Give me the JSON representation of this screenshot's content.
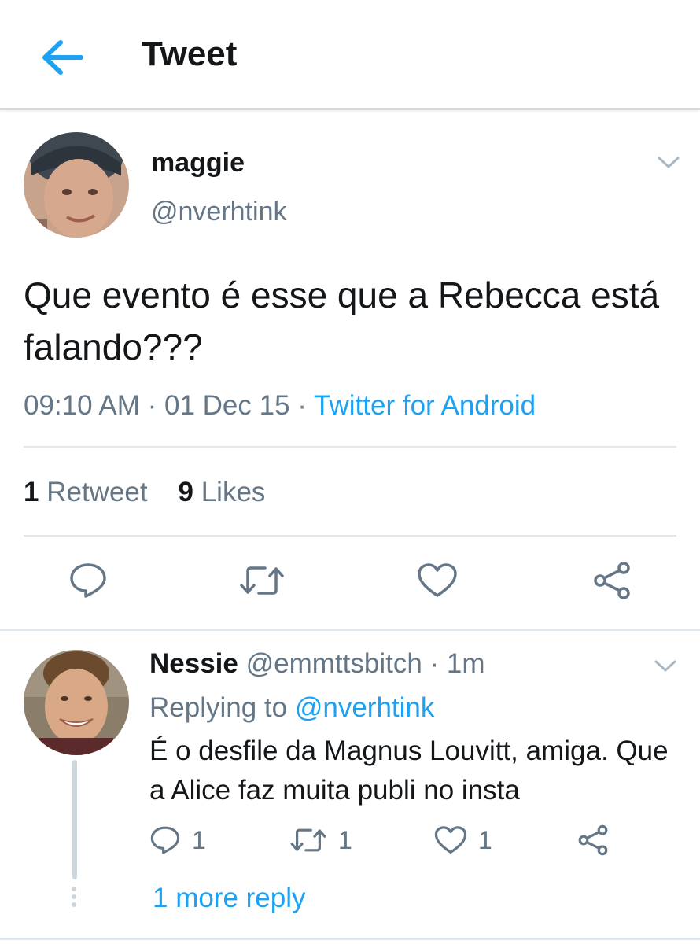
{
  "header": {
    "title": "Tweet",
    "back_icon": "arrow-left-icon",
    "accent": "#1da1f2"
  },
  "tweet": {
    "author_name": "maggie",
    "author_handle": "@nverhtink",
    "text": "Que evento é esse que a Rebecca está falando???",
    "time": "09:10 AM",
    "sep1": " · ",
    "date": "01 Dec 15",
    "sep2": " · ",
    "source": "Twitter for Android",
    "retweet_count": "1",
    "retweet_label": "Retweet",
    "like_count": "9",
    "like_label": "Likes",
    "actions": [
      "reply-icon",
      "retweet-icon",
      "like-icon",
      "share-icon"
    ]
  },
  "reply": {
    "author_name": "Nessie",
    "author_handle": "@emmttsbitch",
    "sep": " · ",
    "time": "1m",
    "replying_prefix": "Replying to ",
    "replying_to": "@nverhtink",
    "text": "É o desfile da Magnus Louvitt, amiga. Que a Alice faz muita publi no insta",
    "reply_count": "1",
    "retweet_count": "1",
    "like_count": "1",
    "more_replies": "1 more reply"
  },
  "colors": {
    "text": "#14171a",
    "secondary": "#657786",
    "link": "#1da1f2",
    "divider": "#e1e8ed",
    "icon": "#657786"
  }
}
